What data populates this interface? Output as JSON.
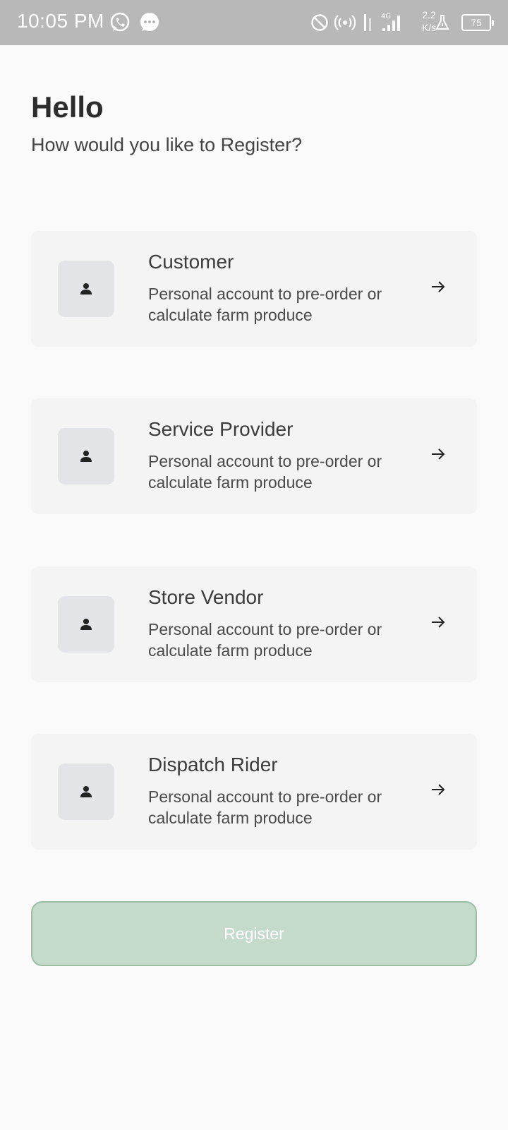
{
  "status_bar": {
    "time": "10:05 PM",
    "net_speed_value": "2.2",
    "net_speed_unit": "K/s",
    "network_type": "4G",
    "battery": "75",
    "icons": [
      "whatsapp-icon",
      "messages-icon",
      "do-not-disturb-icon",
      "hotspot-icon",
      "data-transfer-icon",
      "signal-icon",
      "flask-icon",
      "battery-icon"
    ]
  },
  "header": {
    "greeting": "Hello",
    "subtitle": "How would you like to Register?"
  },
  "options": [
    {
      "title": "Customer",
      "description": "Personal account to pre-order or calculate farm produce",
      "icon": "person-icon"
    },
    {
      "title": "Service Provider",
      "description": "Personal account to pre-order or calculate farm produce",
      "icon": "person-icon"
    },
    {
      "title": "Store Vendor",
      "description": "Personal account to pre-order or calculate farm produce",
      "icon": "person-icon"
    },
    {
      "title": "Dispatch Rider",
      "description": "Personal account to pre-order or calculate farm produce",
      "icon": "person-icon"
    }
  ],
  "register_button": {
    "label": "Register"
  },
  "colors": {
    "background": "#fafafa",
    "card": "#f4f4f4",
    "icon_box": "#e2e4e7",
    "button_fill": "#c4dacb",
    "button_border": "#9bbea5",
    "status_bar": "#b8b8b8"
  }
}
